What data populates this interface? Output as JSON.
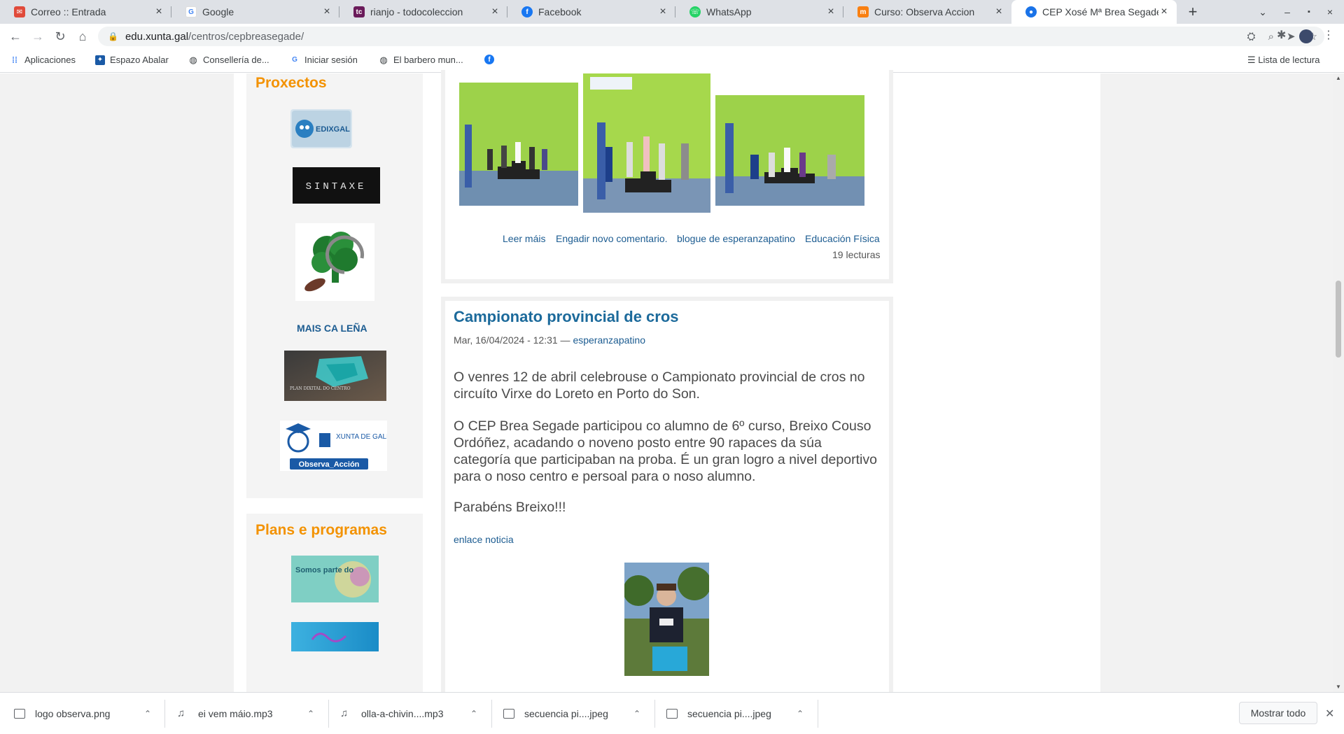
{
  "tabs": [
    {
      "title": "Correo :: Entrada",
      "icon": "mail-icon",
      "color": "#e04a3a"
    },
    {
      "title": "Google",
      "icon": "google-icon",
      "color": "#4285f4"
    },
    {
      "title": "rianjo - todocoleccion",
      "icon": "todocoleccion-icon",
      "color": "#6a1b5a"
    },
    {
      "title": "Facebook",
      "icon": "facebook-icon",
      "color": "#1877f2"
    },
    {
      "title": "WhatsApp",
      "icon": "whatsapp-icon",
      "color": "#25d366"
    },
    {
      "title": "Curso: Observa Accion",
      "icon": "moodle-icon",
      "color": "#f98012"
    },
    {
      "title": "CEP Xosé Mª Brea Segade",
      "icon": "site-icon",
      "color": "#1a73e8"
    }
  ],
  "address": {
    "host": "edu.xunta.gal",
    "path": "/centros/cepbreasegade/"
  },
  "bookmarks": {
    "apps": "Aplicaciones",
    "espazo": "Espazo Abalar",
    "conselleria": "Consellería de...",
    "iniciar": "Iniciar sesión",
    "barbero": "El barbero mun...",
    "reading_list": "Lista de lectura"
  },
  "sidebar": {
    "proxectos_heading": "Proxectos",
    "edixgal_text": "EDIXGAL",
    "sintaxe_text": "SINTAXE",
    "mais_ca_lena": "MAIS CA LEÑA",
    "plan_dixital_text": "PLAN DIXITAL DO CENTRO",
    "observa_xunta": "XUNTA DE GALICIA",
    "observa_label": "Observa_Acción",
    "plans_heading": "Plans e programas",
    "somos_text": "Somos parte do"
  },
  "previous_post": {
    "links": [
      "Leer máis",
      "Engadir novo comentario.",
      "blogue de esperanzapatino",
      "Educación Física"
    ],
    "reads": "19 lecturas"
  },
  "post": {
    "title": "Campionato provincial de cros",
    "date": "Mar, 16/04/2024 - 12:31 — ",
    "author": "esperanzapatino",
    "p1": "O venres 12 de abril celebrouse o Campionato provincial de cros no circuíto Virxe do Loreto en Porto do Son.",
    "p2": "O CEP Brea Segade participou co alumno de 6º curso, Breixo Couso Ordóñez, acadando o noveno posto entre 90 rapaces da súa categoría que participaban na proba. É un gran logro a nivel deportivo para o noso centro e persoal para o noso alumno.",
    "p3": "Parabéns Breixo!!!",
    "link": "enlace noticia"
  },
  "downloads": [
    {
      "name": "logo observa.png",
      "type": "image"
    },
    {
      "name": "ei vem máio.mp3",
      "type": "audio"
    },
    {
      "name": "olla-a-chivin....mp3",
      "type": "audio"
    },
    {
      "name": "secuencia pi....jpeg",
      "type": "image"
    },
    {
      "name": "secuencia pi....jpeg",
      "type": "image"
    }
  ],
  "show_all": "Mostrar todo",
  "colors": {
    "accent_orange": "#f39200",
    "link_blue": "#1c5c91",
    "title_blue": "#1c6a9b"
  }
}
